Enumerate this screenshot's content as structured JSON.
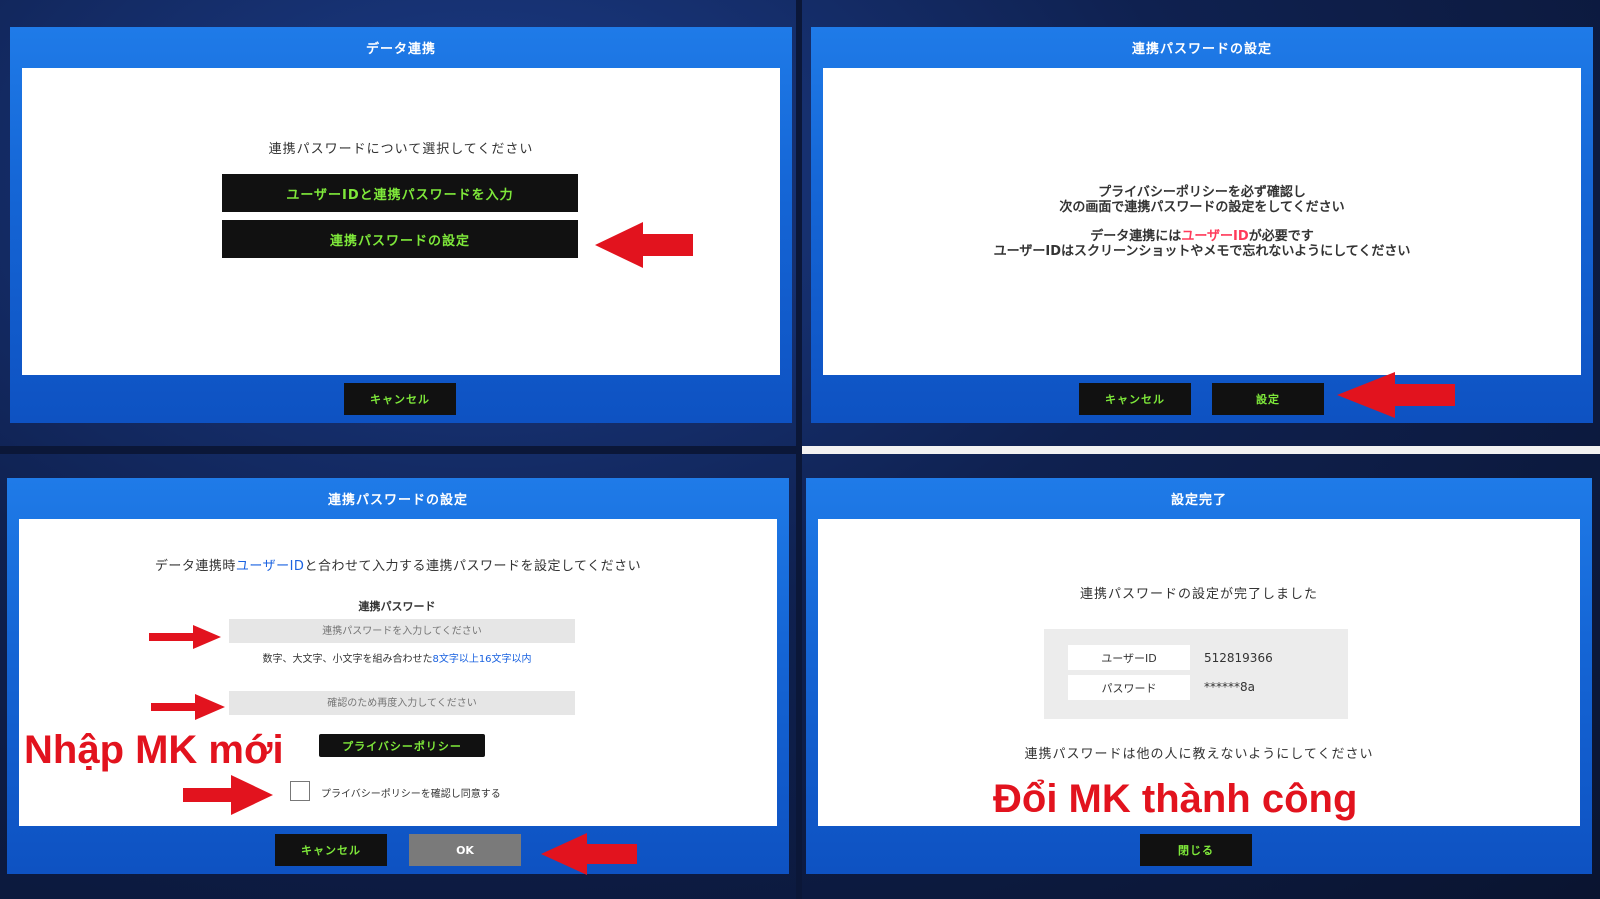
{
  "panel1": {
    "title": "データ連携",
    "prompt": "連携パスワードについて選択してください",
    "option1": "ユーザーIDと連携パスワードを入力",
    "option2": "連携パスワードの設定",
    "cancel": "キャンセル"
  },
  "panel2": {
    "title": "連携パスワードの設定",
    "line1": "プライバシーポリシーを必ず確認し",
    "line2": "次の画面で連携パスワードの設定をしてください",
    "line3_pre": "データ連携には",
    "line3_hl": "ユーザーID",
    "line3_post": "が必要です",
    "line4": "ユーザーIDはスクリーンショットやメモで忘れないようにしてください",
    "cancel": "キャンセル",
    "set": "設定"
  },
  "panel3": {
    "title": "連携パスワードの設定",
    "intro_pre": "データ連携時",
    "intro_hl": "ユーザーID",
    "intro_post": "と合わせて入力する連携パスワードを設定してください",
    "field_label": "連携パスワード",
    "password_placeholder": "連携パスワードを入力してください",
    "hint_pre": "数字、大文字、小文字を組み合わせた",
    "hint_hl": "8文字以上16文字以内",
    "confirm_placeholder": "確認のため再度入力してください",
    "privacy_button": "プライバシーポリシー",
    "agree_label": "プライバシーポリシーを確認し同意する",
    "cancel": "キャンセル",
    "ok": "OK"
  },
  "panel4": {
    "title": "設定完了",
    "message": "連携パスワードの設定が完了しました",
    "user_id_label": "ユーザーID",
    "user_id_value": "512819366",
    "password_label": "パスワード",
    "password_value": "******8a",
    "warning": "連携パスワードは他の人に教えないようにしてください",
    "close": "閉じる"
  },
  "annotations": {
    "new_password": "Nhập MK mới",
    "success": "Đổi MK thành công"
  },
  "colors": {
    "arrow": "#e2131e",
    "button_text": "#7ee83a",
    "panel_blue": "#1566d6"
  }
}
